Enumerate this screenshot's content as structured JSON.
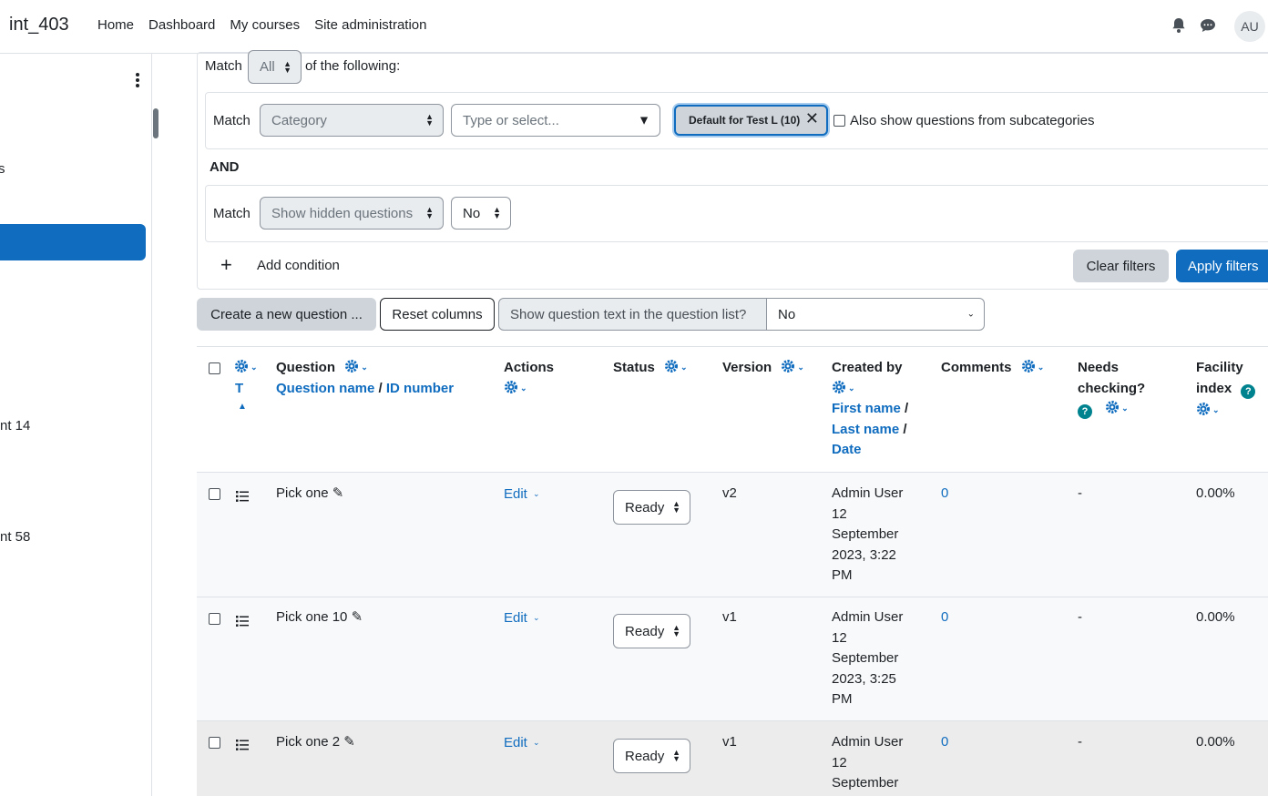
{
  "navbar": {
    "brand": "int_403",
    "links": [
      "Home",
      "Dashboard",
      "My courses",
      "Site administration"
    ],
    "avatar_initials": "AU",
    "icons": [
      "bell-icon",
      "chat-icon"
    ]
  },
  "drawer": {
    "items": [
      "s",
      "nt 14",
      "nt 58"
    ]
  },
  "filters": {
    "match_label": "Match",
    "match_value": "All",
    "of_following": "of the following:",
    "cond1": {
      "match_label": "Match",
      "field": "Category",
      "search_placeholder": "Type or select...",
      "chip": "Default for Test L (10)",
      "subcategories_label": "Also show questions from subcategories"
    },
    "and_label": "AND",
    "cond2": {
      "match_label": "Match",
      "field": "Show hidden questions",
      "value": "No"
    },
    "add_condition": "Add condition",
    "clear_filters": "Clear filters",
    "apply_filters": "Apply filters"
  },
  "toolbar": {
    "create_question": "Create a new question ...",
    "reset_columns": "Reset columns",
    "show_text_label": "Show question text in the question list?",
    "show_text_value": "No"
  },
  "table": {
    "headers": {
      "type_sort": "T",
      "question": "Question",
      "question_name": "Question name",
      "id_number": "ID number",
      "actions": "Actions",
      "status": "Status",
      "version": "Version",
      "created_by": "Created by",
      "first_name": "First name",
      "last_name": "Last name",
      "date": "Date",
      "comments": "Comments",
      "needs_checking_1": "Needs",
      "needs_checking_2": "checking?",
      "facility_1": "Facility",
      "facility_2": "index",
      "slash": "/"
    },
    "rows": [
      {
        "name": "Pick one",
        "action": "Edit",
        "status": "Ready",
        "version": "v2",
        "created": [
          "Admin User",
          "12",
          "September",
          "2023, 3:22",
          "PM"
        ],
        "comments": "0",
        "needs_checking": "-",
        "facility": "0.00%"
      },
      {
        "name": "Pick one 10",
        "action": "Edit",
        "status": "Ready",
        "version": "v1",
        "created": [
          "Admin User",
          "12",
          "September",
          "2023, 3:25",
          "PM"
        ],
        "comments": "0",
        "needs_checking": "-",
        "facility": "0.00%"
      },
      {
        "name": "Pick one 2",
        "action": "Edit",
        "status": "Ready",
        "version": "v1",
        "created": [
          "Admin User",
          "12",
          "September"
        ],
        "comments": "0",
        "needs_checking": "-",
        "facility": "0.00%"
      }
    ]
  },
  "colors": {
    "primary": "#0f6cbf",
    "help": "#00838f"
  }
}
